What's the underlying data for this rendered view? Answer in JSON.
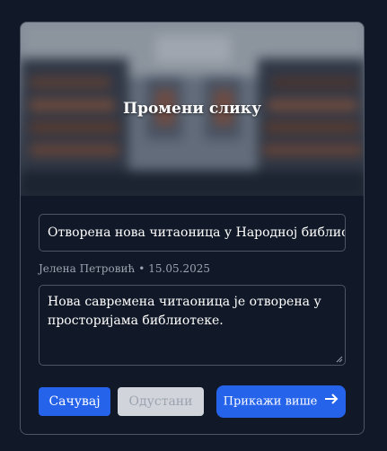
{
  "hero": {
    "change_image_label": "Промени слику"
  },
  "article": {
    "title_value": "Отворена нова читаоница у Народној библиотеци",
    "author": "Јелена Петровић",
    "separator": "•",
    "date": "15.05.2025",
    "description": "Нова савремена читаоница је отворена у просторијама библиотеке."
  },
  "actions": {
    "save_label": "Сачувај",
    "cancel_label": "Одустани",
    "more_label": "Прикажи више"
  },
  "colors": {
    "background": "#111827",
    "primary": "#2563eb",
    "border": "#4b5563",
    "muted_text": "#9ca3af",
    "disabled_bg": "#d1d5db"
  },
  "icons": {
    "more_button": "arrow-right-icon"
  }
}
